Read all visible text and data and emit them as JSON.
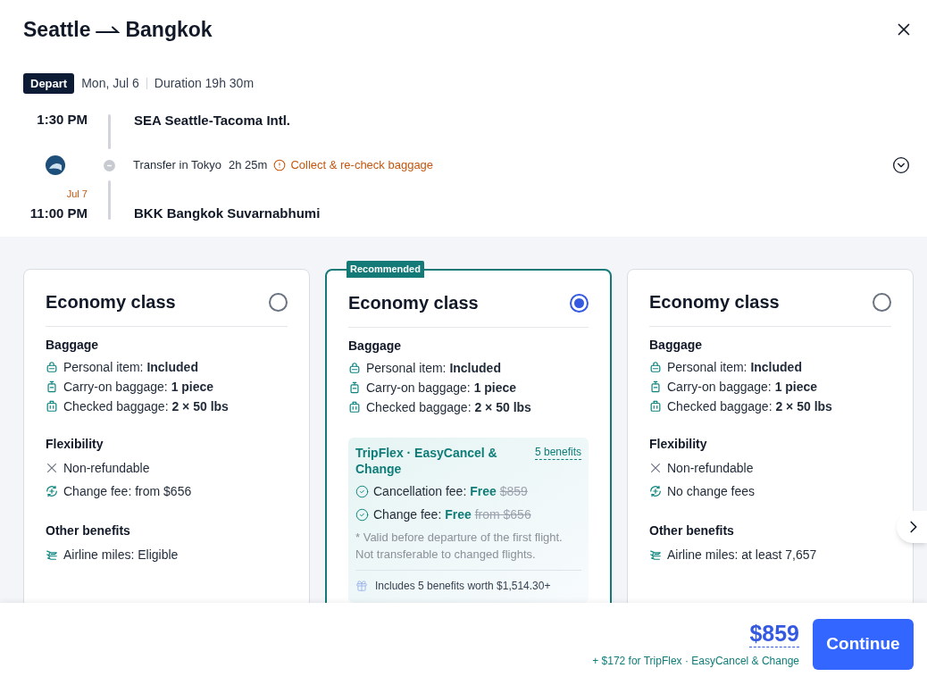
{
  "title": {
    "origin": "Seattle",
    "destination": "Bangkok"
  },
  "flight": {
    "badge": "Depart",
    "date": "Mon, Jul 6",
    "duration": "Duration 19h 30m",
    "departure": {
      "time": "1:30 PM",
      "airport": "SEA Seattle-Tacoma Intl."
    },
    "transfer": {
      "text": "Transfer in Tokyo",
      "duration": "2h 25m",
      "warning": "Collect & re-check baggage"
    },
    "arrival": {
      "day_note": "Jul 7",
      "time": "11:00 PM",
      "airport": "BKK Bangkok Suvarnabhumi"
    }
  },
  "fare_options": [
    {
      "title": "Economy class",
      "selected": false,
      "sections": [
        {
          "heading": "Baggage",
          "items": [
            {
              "kind": "personal-item",
              "text": "Personal item: **Included**"
            },
            {
              "kind": "carry-on",
              "text": "Carry-on baggage: **1 piece**"
            },
            {
              "kind": "checked-bag",
              "text": "Checked baggage: **2 × 50 lbs**"
            }
          ]
        },
        {
          "heading": "Flexibility",
          "items": [
            {
              "kind": "no-refund",
              "text": "Non-refundable"
            },
            {
              "kind": "change-fee",
              "text": "Change fee: from $656"
            }
          ]
        },
        {
          "heading": "Other benefits",
          "items": [
            {
              "kind": "miles",
              "text": "Airline miles: Eligible"
            }
          ]
        }
      ]
    },
    {
      "title": "Economy class",
      "selected": true,
      "badge": "Recommended",
      "sections": [
        {
          "heading": "Baggage",
          "items": [
            {
              "kind": "personal-item",
              "text": "Personal item: **Included**"
            },
            {
              "kind": "carry-on",
              "text": "Carry-on baggage: **1 piece**"
            },
            {
              "kind": "checked-bag",
              "text": "Checked baggage: **2 × 50 lbs**"
            }
          ]
        }
      ],
      "tripflex": {
        "title": "TripFlex · EasyCancel & Change",
        "link": "5 benefits",
        "rows": [
          {
            "label": "Cancellation fee:",
            "value": "Free",
            "was": "$859"
          },
          {
            "label": "Change fee:",
            "value": "Free",
            "was": "from $656"
          }
        ],
        "note": "* Valid before departure of the first flight. Not transferable to changed flights.",
        "summary": "Includes 5 benefits worth $1,514.30+"
      }
    },
    {
      "title": "Economy class",
      "selected": false,
      "sections": [
        {
          "heading": "Baggage",
          "items": [
            {
              "kind": "personal-item",
              "text": "Personal item: **Included**"
            },
            {
              "kind": "carry-on",
              "text": "Carry-on baggage: **1 piece**"
            },
            {
              "kind": "checked-bag",
              "text": "Checked baggage: **2 × 50 lbs**"
            }
          ]
        },
        {
          "heading": "Flexibility",
          "items": [
            {
              "kind": "no-refund",
              "text": "Non-refundable"
            },
            {
              "kind": "change-fee",
              "text": "No change fees"
            }
          ]
        },
        {
          "heading": "Other benefits",
          "items": [
            {
              "kind": "miles",
              "text": "Airline miles: at least 7,657"
            }
          ]
        }
      ]
    }
  ],
  "footer": {
    "price": "$859",
    "addon": "+ $172 for TripFlex · EasyCancel & Change",
    "button": "Continue"
  }
}
